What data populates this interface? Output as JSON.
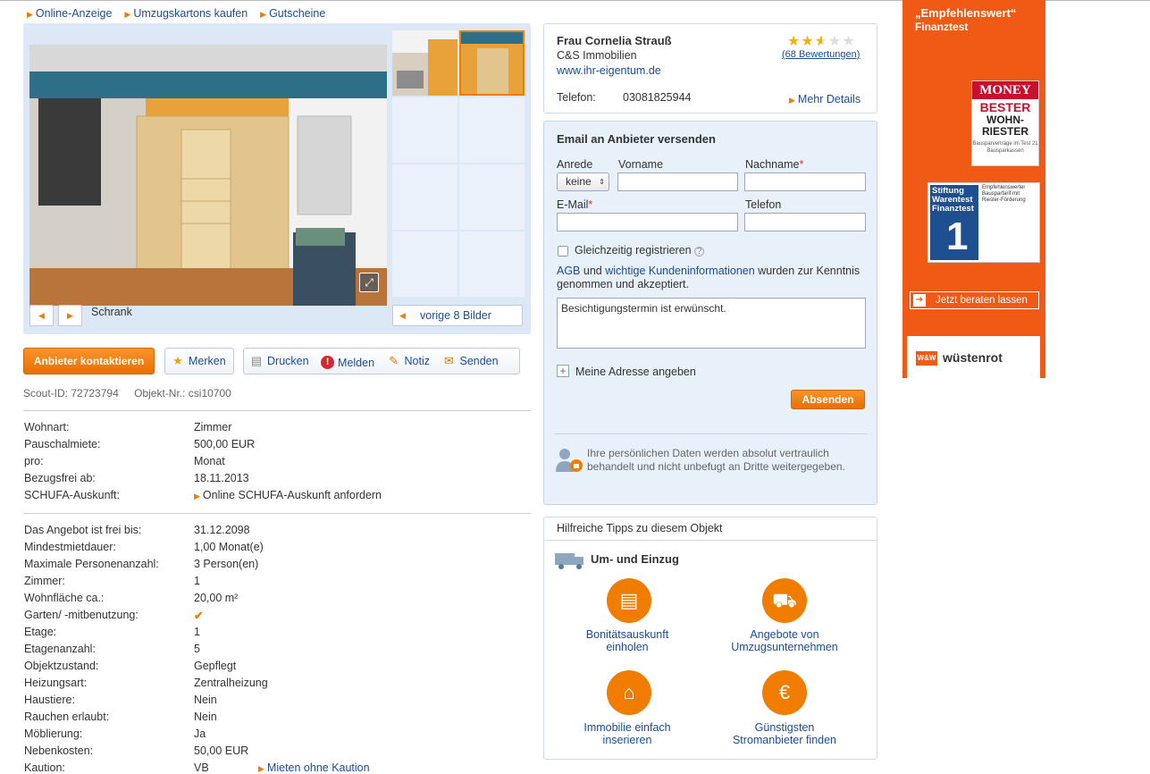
{
  "toplinks": [
    "Online-Anzeige",
    "Umzugskartons kaufen",
    "Gutscheine"
  ],
  "gallery": {
    "caption": "Schrank",
    "prev_label": "vorige 8 Bilder",
    "thumb_count": 8
  },
  "actions": {
    "contact_label": "Anbieter kontaktieren",
    "merken": "Merken",
    "drucken": "Drucken",
    "melden": "Melden",
    "notiz": "Notiz",
    "senden": "Senden"
  },
  "ids": {
    "scout_id": "Scout-ID: 72723794",
    "objekt_nr": "Objekt-Nr.: csi10700"
  },
  "details_primary": [
    {
      "k": "Wohnart:",
      "v": "Zimmer"
    },
    {
      "k": "Pauschalmiete:",
      "v": "500,00 EUR"
    },
    {
      "k": "pro:",
      "v": "Monat"
    },
    {
      "k": "Bezugsfrei ab:",
      "v": "18.11.2013"
    },
    {
      "k": "SCHUFA-Auskunft:",
      "v": "Online SCHUFA-Auskunft anfordern",
      "link": true
    }
  ],
  "details_secondary": [
    {
      "k": "Das Angebot ist frei bis:",
      "v": "31.12.2098"
    },
    {
      "k": "Mindestmietdauer:",
      "v": "1,00 Monat(e)"
    },
    {
      "k": "Maximale Personenanzahl:",
      "v": "3 Person(en)"
    },
    {
      "k": "Zimmer:",
      "v": "1"
    },
    {
      "k": "Wohnfläche ca.:",
      "v": "20,00 m²"
    },
    {
      "k": "Garten/ -mitbenutzung:",
      "v": "✔",
      "check": true
    },
    {
      "k": "Etage:",
      "v": "1"
    },
    {
      "k": "Etagenanzahl:",
      "v": "5"
    },
    {
      "k": "Objektzustand:",
      "v": "Gepflegt"
    },
    {
      "k": "Heizungsart:",
      "v": "Zentralheizung"
    },
    {
      "k": "Haustiere:",
      "v": "Nein"
    },
    {
      "k": "Rauchen erlaubt:",
      "v": "Nein"
    },
    {
      "k": "Möblierung:",
      "v": "Ja"
    },
    {
      "k": "Nebenkosten:",
      "v": "50,00 EUR"
    },
    {
      "k": "Kaution:",
      "v": "VB",
      "extra_link": "Mieten ohne Kaution"
    }
  ],
  "contact": {
    "name": "Frau Cornelia Strauß",
    "company": "C&S Immobilien",
    "website": "www.ihr-eigentum.de",
    "phone_label": "Telefon:",
    "phone": "03081825944",
    "more_details": "Mehr Details",
    "rating_stars": 2.5,
    "rating_max": 5,
    "ratings_label": "(68 Bewertungen)"
  },
  "email_form": {
    "title": "Email an Anbieter versenden",
    "anrede_label": "Anrede",
    "anrede_value": "keine",
    "vorname_label": "Vorname",
    "nachname_label": "Nachname",
    "email_label": "E-Mail",
    "telefon_label": "Telefon",
    "register_label": "Gleichzeitig registrieren",
    "agb_link": "AGB",
    "agb_und": "und",
    "kunden_link": "wichtige Kundeninformationen",
    "agb_text_1": "wurden zur Kenntnis",
    "agb_text_2": "genommen und akzeptiert.",
    "message": "Besichtigungstermin ist erwünscht.",
    "address_link": "Meine Adresse angeben",
    "send_label": "Absenden",
    "privacy": "Ihre persönlichen Daten werden absolut vertraulich behandelt und nicht unbefugt an Dritte weitergegeben."
  },
  "tips": {
    "header": "Hilfreiche Tipps zu diesem Objekt",
    "section": "Um- und Einzug",
    "items": [
      {
        "l1": "Bonitätsauskunft",
        "l2": "einholen",
        "icon": "document-icon"
      },
      {
        "l1": "Angebote von",
        "l2": "Umzugsunternehmen",
        "icon": "truck-icon"
      },
      {
        "l1": "Immobilie einfach",
        "l2": "inserieren",
        "icon": "house-check-icon"
      },
      {
        "l1": "Günstigsten",
        "l2": "Stromanbieter finden",
        "icon": "euro-plug-icon"
      }
    ]
  },
  "ad": {
    "headline": "„Empfehlenswert“",
    "sub": "Finanztest",
    "money_brand": "MONEY",
    "money_l1": "BESTER",
    "money_l2": "WOHN-",
    "money_l3": "RIESTER",
    "stiftung": "Stiftung Warentest",
    "finanztest": "Finanztest",
    "stift_text": "Empfehlenswerter Bausparfarif mit Riester-Förderung",
    "cta": "Jetzt beraten lassen",
    "brand": "wüstenrot",
    "brand_logo": "W&W",
    "color": "#f05a14"
  }
}
